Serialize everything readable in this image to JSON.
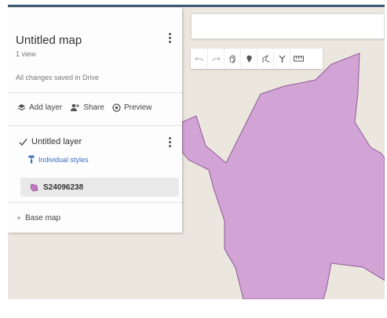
{
  "map": {
    "title": "Untitled map",
    "views": "1 view",
    "save_status": "All changes saved in Drive"
  },
  "actions": [
    {
      "label": "Add layer",
      "icon": "add-layer-icon"
    },
    {
      "label": "Share",
      "icon": "share-person-icon"
    },
    {
      "label": "Preview",
      "icon": "preview-eye-icon"
    }
  ],
  "layer": {
    "name": "Untitled layer",
    "checked": true,
    "style_label": "Individual styles",
    "feature_label": "S24096238",
    "feature_color": "#c678c8"
  },
  "base_map": {
    "label": "Base map"
  },
  "toolbar": {
    "tools": [
      "undo-icon",
      "redo-icon",
      "hand-pan-icon",
      "add-marker-icon",
      "draw-line-icon",
      "route-icon",
      "measure-ruler-icon"
    ]
  },
  "colors": {
    "map_background": "#ebe7df",
    "polygon_fill": "#d2a4d6",
    "polygon_stroke": "#8f5a96",
    "link_blue": "#3a6fc4",
    "header_bar": "#3c5673"
  }
}
